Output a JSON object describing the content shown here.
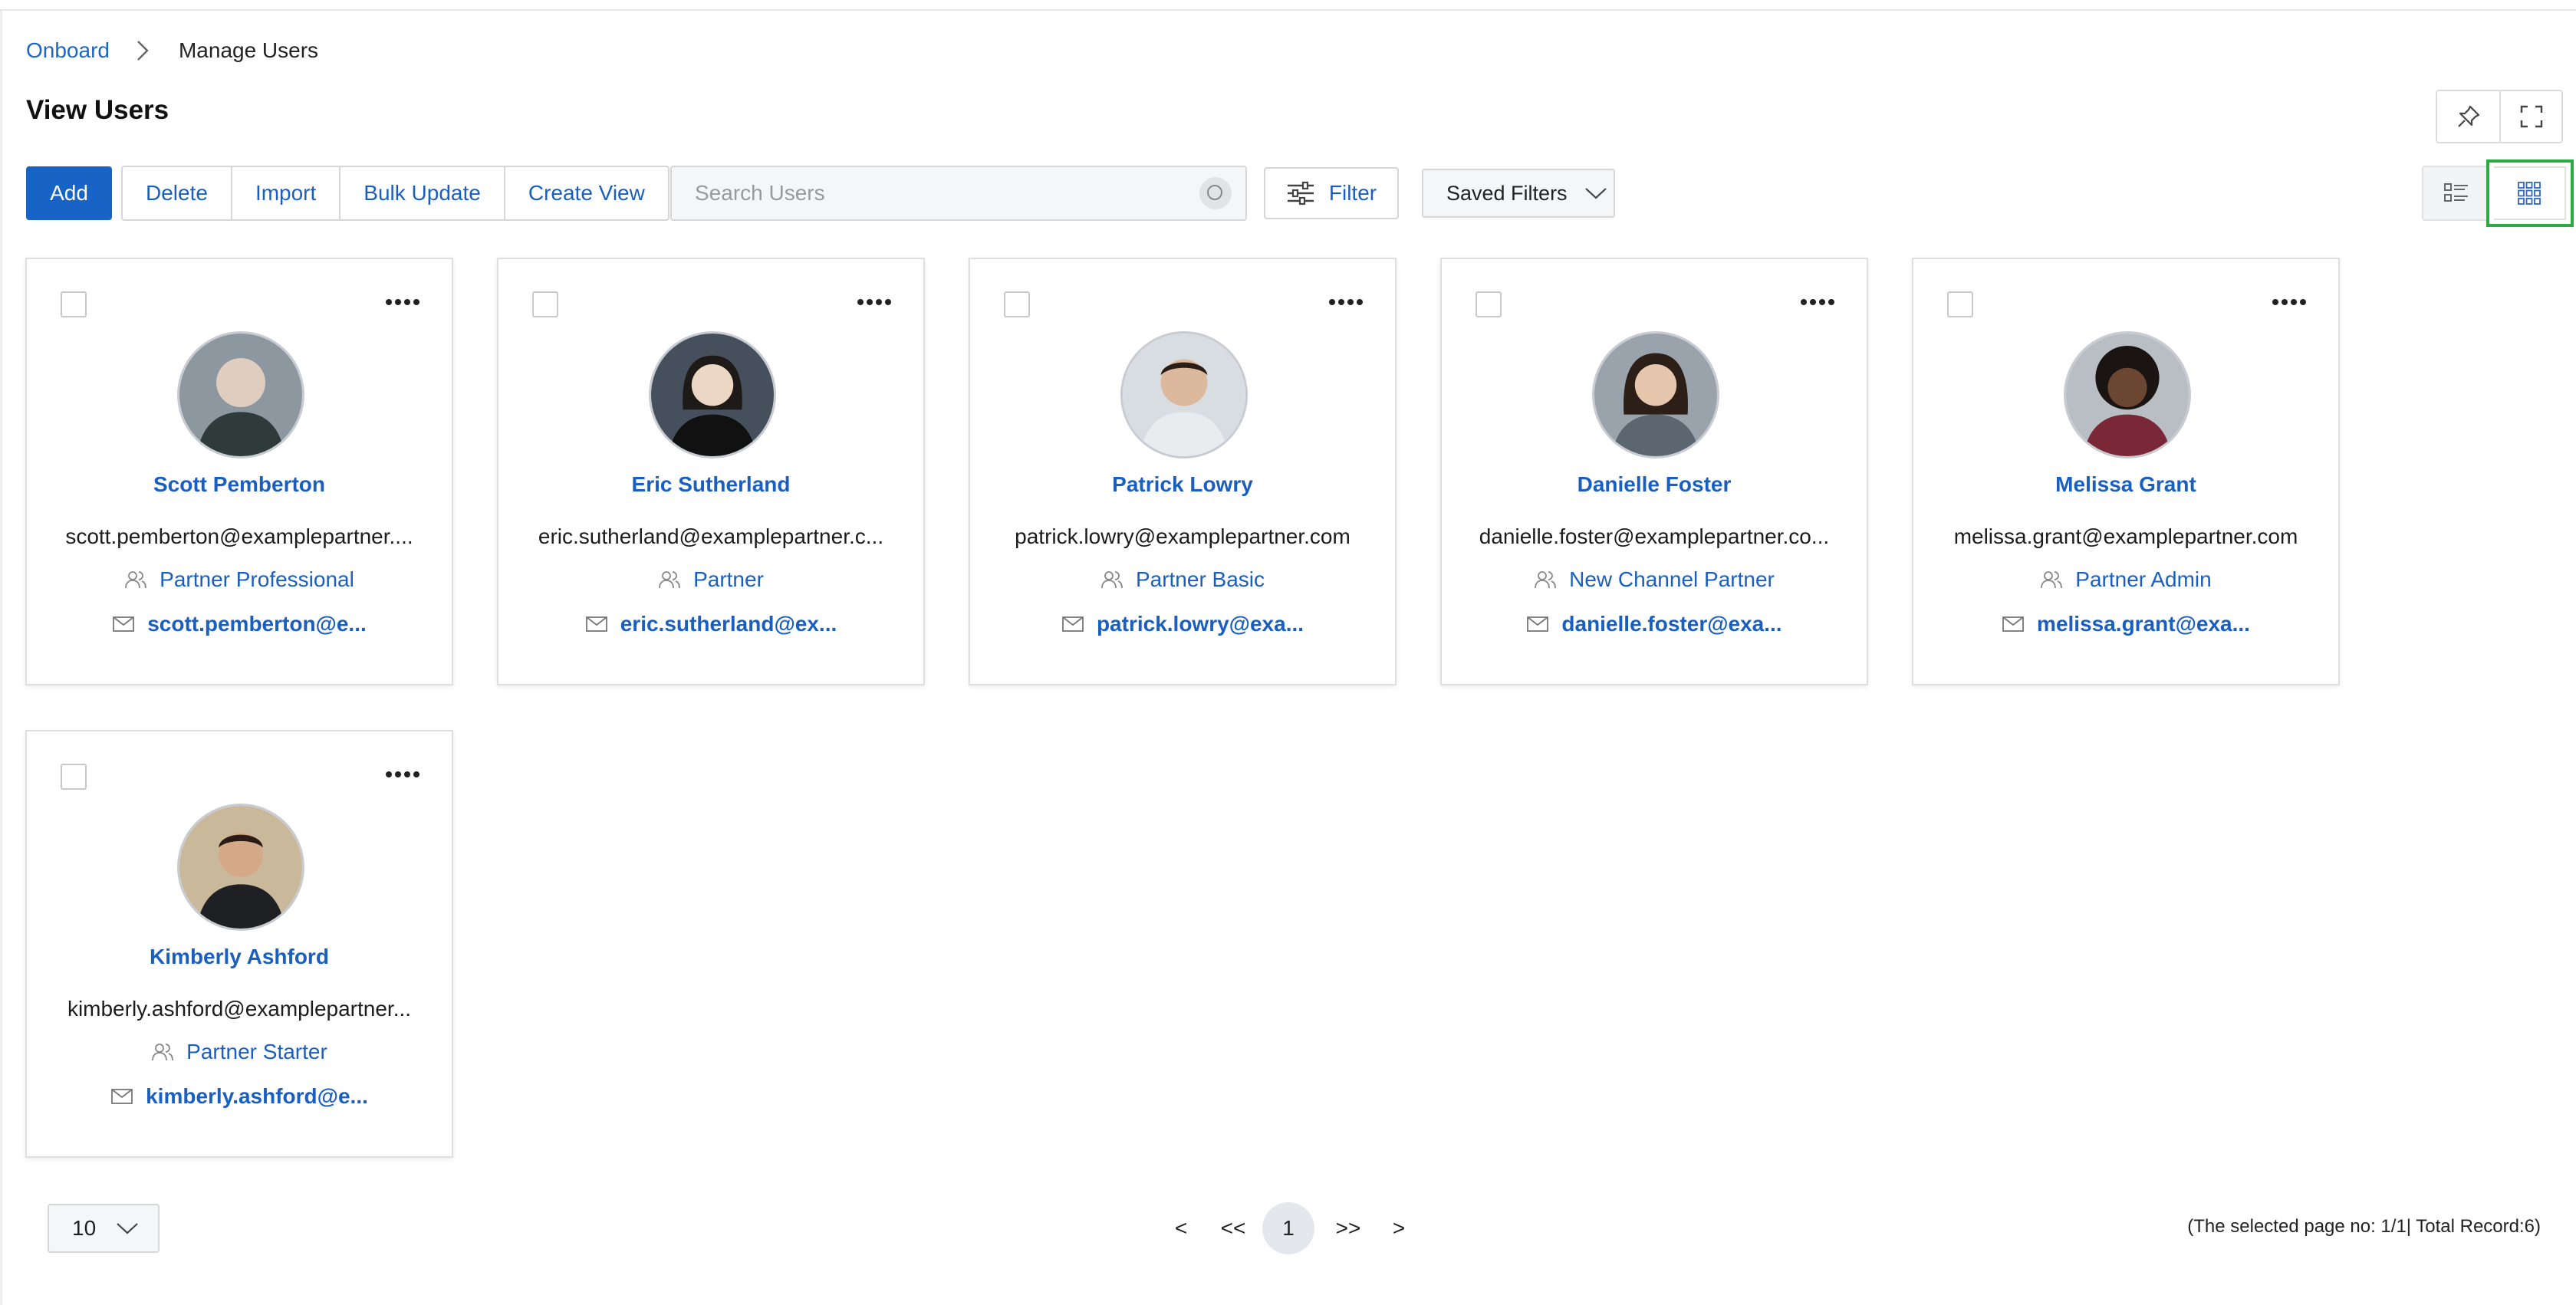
{
  "breadcrumb": {
    "root": "Onboard",
    "current": "Manage Users"
  },
  "page_title": "View Users",
  "toolbar": {
    "add": "Add",
    "delete": "Delete",
    "import": "Import",
    "bulk_update": "Bulk Update",
    "create_view": "Create View",
    "search_placeholder": "Search Users",
    "filter": "Filter",
    "saved_filters": "Saved Filters"
  },
  "users": [
    {
      "name": "Scott Pemberton",
      "email": "scott.pemberton@examplepartner....",
      "role": "Partner Professional",
      "contact": "scott.pemberton@e...",
      "avatar_bg": "#8d97a0"
    },
    {
      "name": "Eric Sutherland",
      "email": "eric.sutherland@examplepartner.c...",
      "role": "Partner",
      "contact": "eric.sutherland@ex...",
      "avatar_bg": "#46505c"
    },
    {
      "name": "Patrick Lowry",
      "email": "patrick.lowry@examplepartner.com",
      "role": "Partner Basic",
      "contact": "patrick.lowry@exa...",
      "avatar_bg": "#d8dde2"
    },
    {
      "name": "Danielle Foster",
      "email": "danielle.foster@examplepartner.co...",
      "role": "New Channel Partner",
      "contact": "danielle.foster@exa...",
      "avatar_bg": "#9aa3ab"
    },
    {
      "name": "Melissa Grant",
      "email": "melissa.grant@examplepartner.com",
      "role": "Partner Admin",
      "contact": "melissa.grant@exa...",
      "avatar_bg": "#b8bec4"
    },
    {
      "name": "Kimberly Ashford",
      "email": "kimberly.ashford@examplepartner...",
      "role": "Partner Starter",
      "contact": "kimberly.ashford@e...",
      "avatar_bg": "#c9b89a"
    }
  ],
  "pagination": {
    "page_size": "10",
    "prev": "<",
    "first": "<<",
    "current_page": "1",
    "last": ">>",
    "next": ">",
    "info": "(The selected page no: 1/1| Total Record:6)"
  },
  "colors": {
    "accent": "#1863c6",
    "link": "#1a5fc0",
    "highlight": "#2eaa45"
  }
}
